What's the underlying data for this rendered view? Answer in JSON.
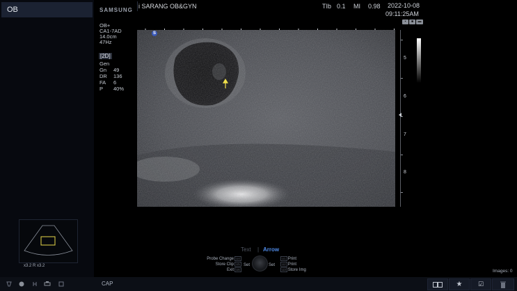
{
  "mode": "OB",
  "brand": "SAMSUNG",
  "hospital": "i SARANG OB&GYN",
  "tib": {
    "label": "TIb",
    "value": "0.1"
  },
  "mi": {
    "label": "MI",
    "value": "0.98"
  },
  "date": "2022-10-08",
  "time": "09:11:25AM",
  "probe": {
    "preset": "OB+",
    "probe": "CA1-7AD",
    "depth": "14.0cm",
    "frame_rate": "47Hz"
  },
  "imaging_mode": "[2D]",
  "gen": "Gen",
  "params": [
    {
      "key": "Gn",
      "value": "49"
    },
    {
      "key": "DR",
      "value": "136"
    },
    {
      "key": "FA",
      "value": "6"
    },
    {
      "key": "P",
      "value": "40%"
    }
  ],
  "depth_marks": [
    "5",
    "6",
    "7",
    "8"
  ],
  "logo_letter": "S",
  "thumb_zoom": "x3.2  R x3.2",
  "annotation": {
    "text_label": "Text",
    "separator": "|",
    "arrow_label": "Arrow"
  },
  "controls_left": [
    {
      "label": "Probe Change",
      "key": "U4"
    },
    {
      "label": "Store Clip",
      "key": "U5"
    },
    {
      "label": "Exit",
      "key": "U6"
    }
  ],
  "controls_right": [
    {
      "key": "U1",
      "label": "Print"
    },
    {
      "key": "U2",
      "label": "Print"
    },
    {
      "key": "U3",
      "label": "Store Img"
    }
  ],
  "knob": {
    "left_label": "Set",
    "right_label": "Set"
  },
  "images_count": "Images: 0",
  "cap_label": "CAP",
  "colors": {
    "mode_box": "#1b2232",
    "arrow_active": "#4f8ae6",
    "logo": "#3a59b8",
    "annotation_arrow": "#f0e04a"
  }
}
